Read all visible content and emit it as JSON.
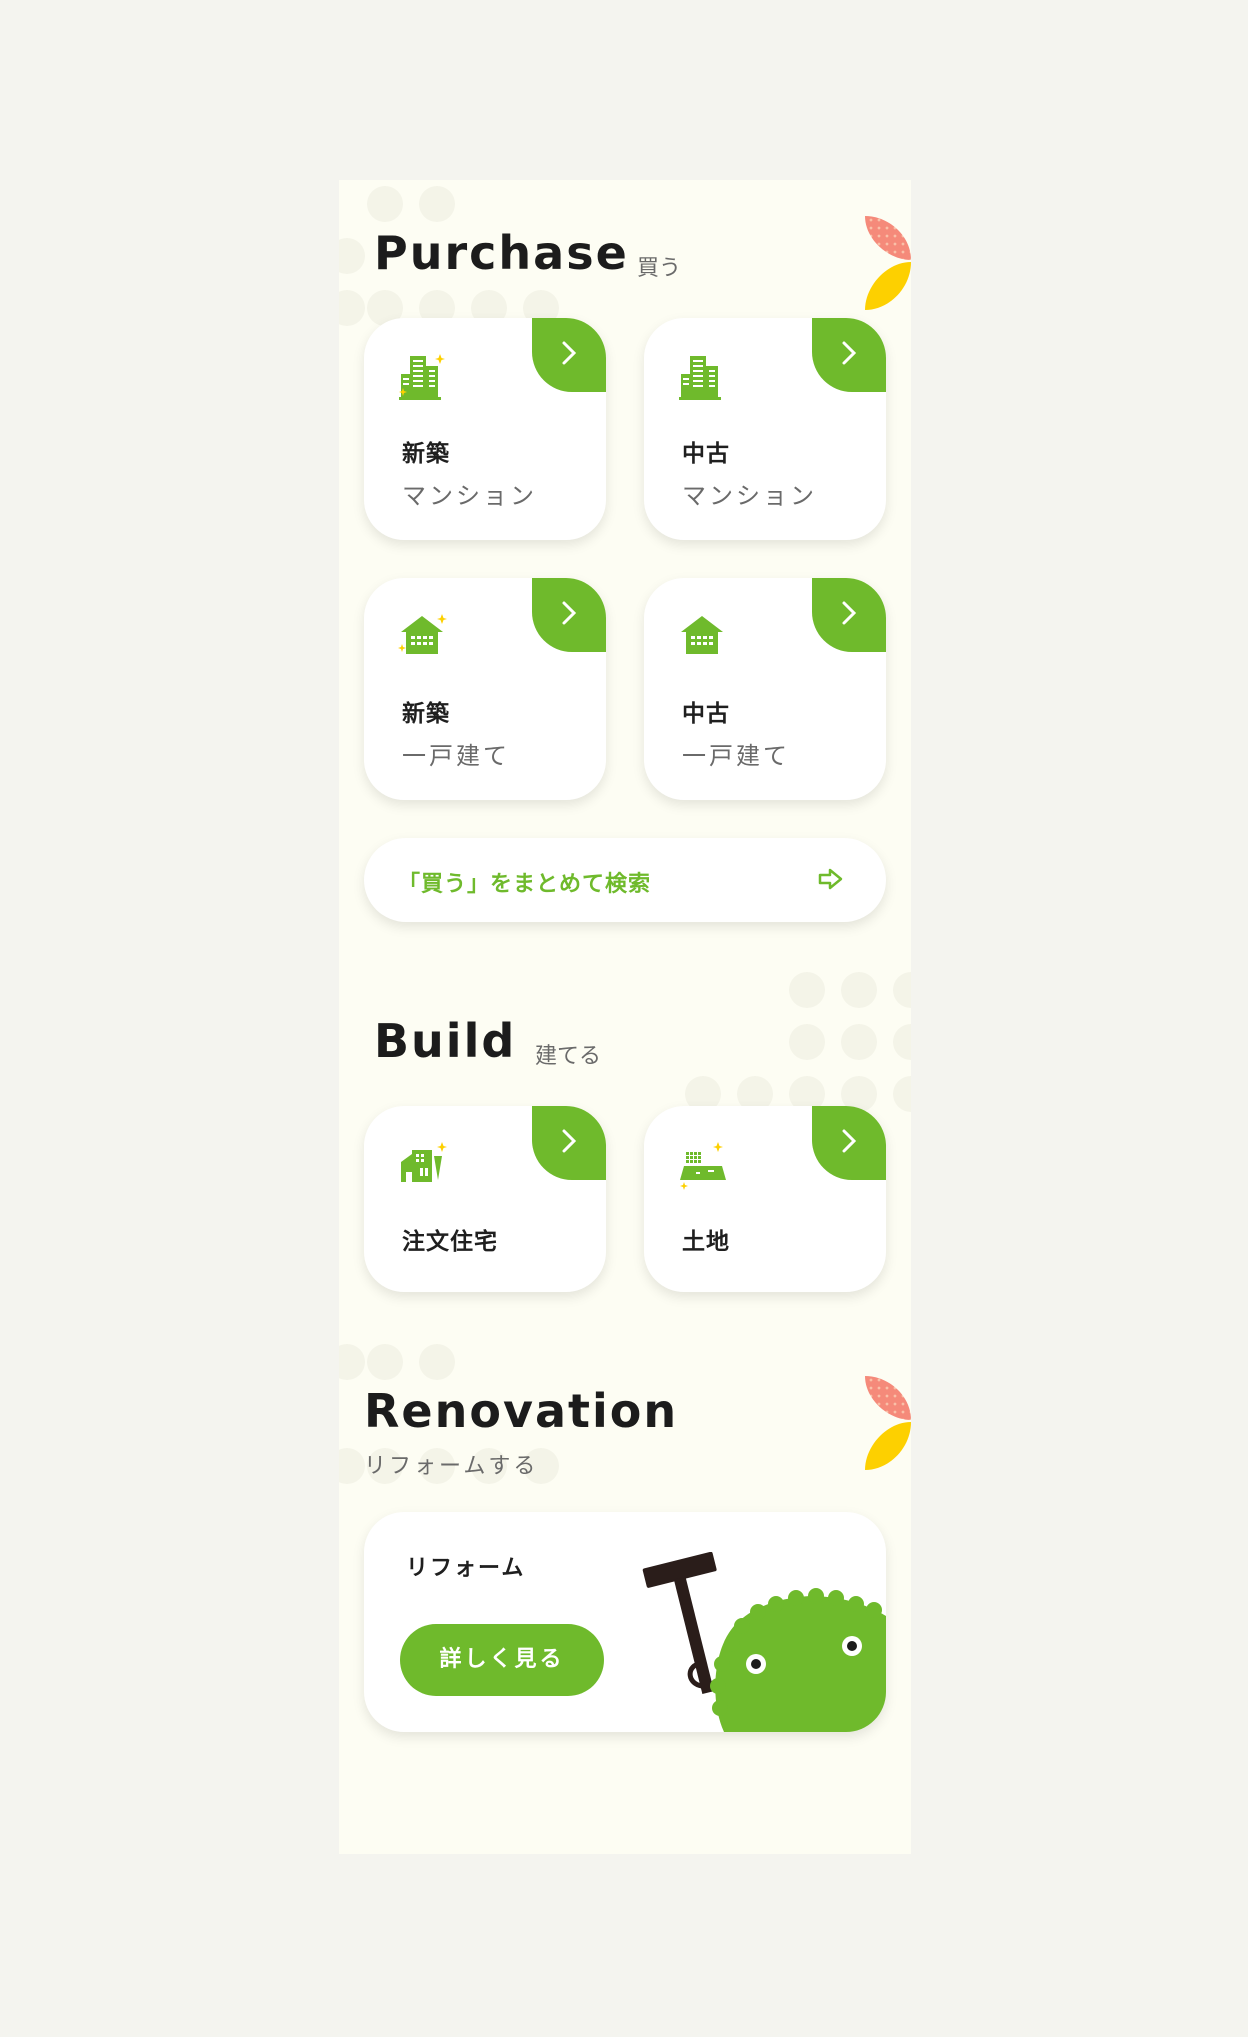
{
  "purchase": {
    "title": "Purchase",
    "subtitle": "買う",
    "cards": [
      {
        "line1": "新築",
        "line2": "マンション",
        "icon": "building-icon"
      },
      {
        "line1": "中古",
        "line2": "マンション",
        "icon": "building-icon"
      },
      {
        "line1": "新築",
        "line2": "一戸建て",
        "icon": "house-icon"
      },
      {
        "line1": "中古",
        "line2": "一戸建て",
        "icon": "house-icon"
      }
    ],
    "search_label": "「買う」をまとめて検索"
  },
  "build": {
    "title": "Build",
    "subtitle": "建てる",
    "cards": [
      {
        "line1": "注文住宅",
        "icon": "custom-house-icon"
      },
      {
        "line1": "土地",
        "icon": "land-icon"
      }
    ]
  },
  "renovation": {
    "title": "Renovation",
    "subtitle": "リフォームする",
    "card_title": "リフォーム",
    "button_label": "詳しく見る"
  },
  "colors": {
    "accent": "#6fba2c",
    "background": "#fdfdf3",
    "page": "#f4f4ef",
    "petal_pink": "#f5907a",
    "petal_yellow": "#fdd000"
  }
}
